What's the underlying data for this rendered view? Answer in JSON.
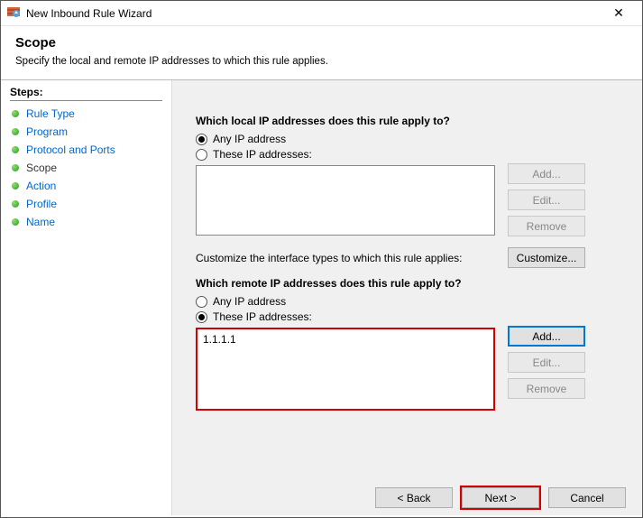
{
  "window": {
    "title": "New Inbound Rule Wizard",
    "close": "✕"
  },
  "header": {
    "title": "Scope",
    "subtitle": "Specify the local and remote IP addresses to which this rule applies."
  },
  "sidebar": {
    "steps_label": "Steps:",
    "items": [
      {
        "label": "Rule Type",
        "current": false
      },
      {
        "label": "Program",
        "current": false
      },
      {
        "label": "Protocol and Ports",
        "current": false
      },
      {
        "label": "Scope",
        "current": true
      },
      {
        "label": "Action",
        "current": false
      },
      {
        "label": "Profile",
        "current": false
      },
      {
        "label": "Name",
        "current": false
      }
    ]
  },
  "local": {
    "question": "Which local IP addresses does this rule apply to?",
    "opt_any": "Any IP address",
    "opt_these": "These IP addresses:",
    "selected": "any",
    "entries": [],
    "buttons": {
      "add": "Add...",
      "edit": "Edit...",
      "remove": "Remove"
    }
  },
  "customize": {
    "text": "Customize the interface types to which this rule applies:",
    "button": "Customize..."
  },
  "remote": {
    "question": "Which remote IP addresses does this rule apply to?",
    "opt_any": "Any IP address",
    "opt_these": "These IP addresses:",
    "selected": "these",
    "entries": [
      "1.1.1.1"
    ],
    "buttons": {
      "add": "Add...",
      "edit": "Edit...",
      "remove": "Remove"
    }
  },
  "footer": {
    "back": "< Back",
    "next": "Next >",
    "cancel": "Cancel"
  }
}
